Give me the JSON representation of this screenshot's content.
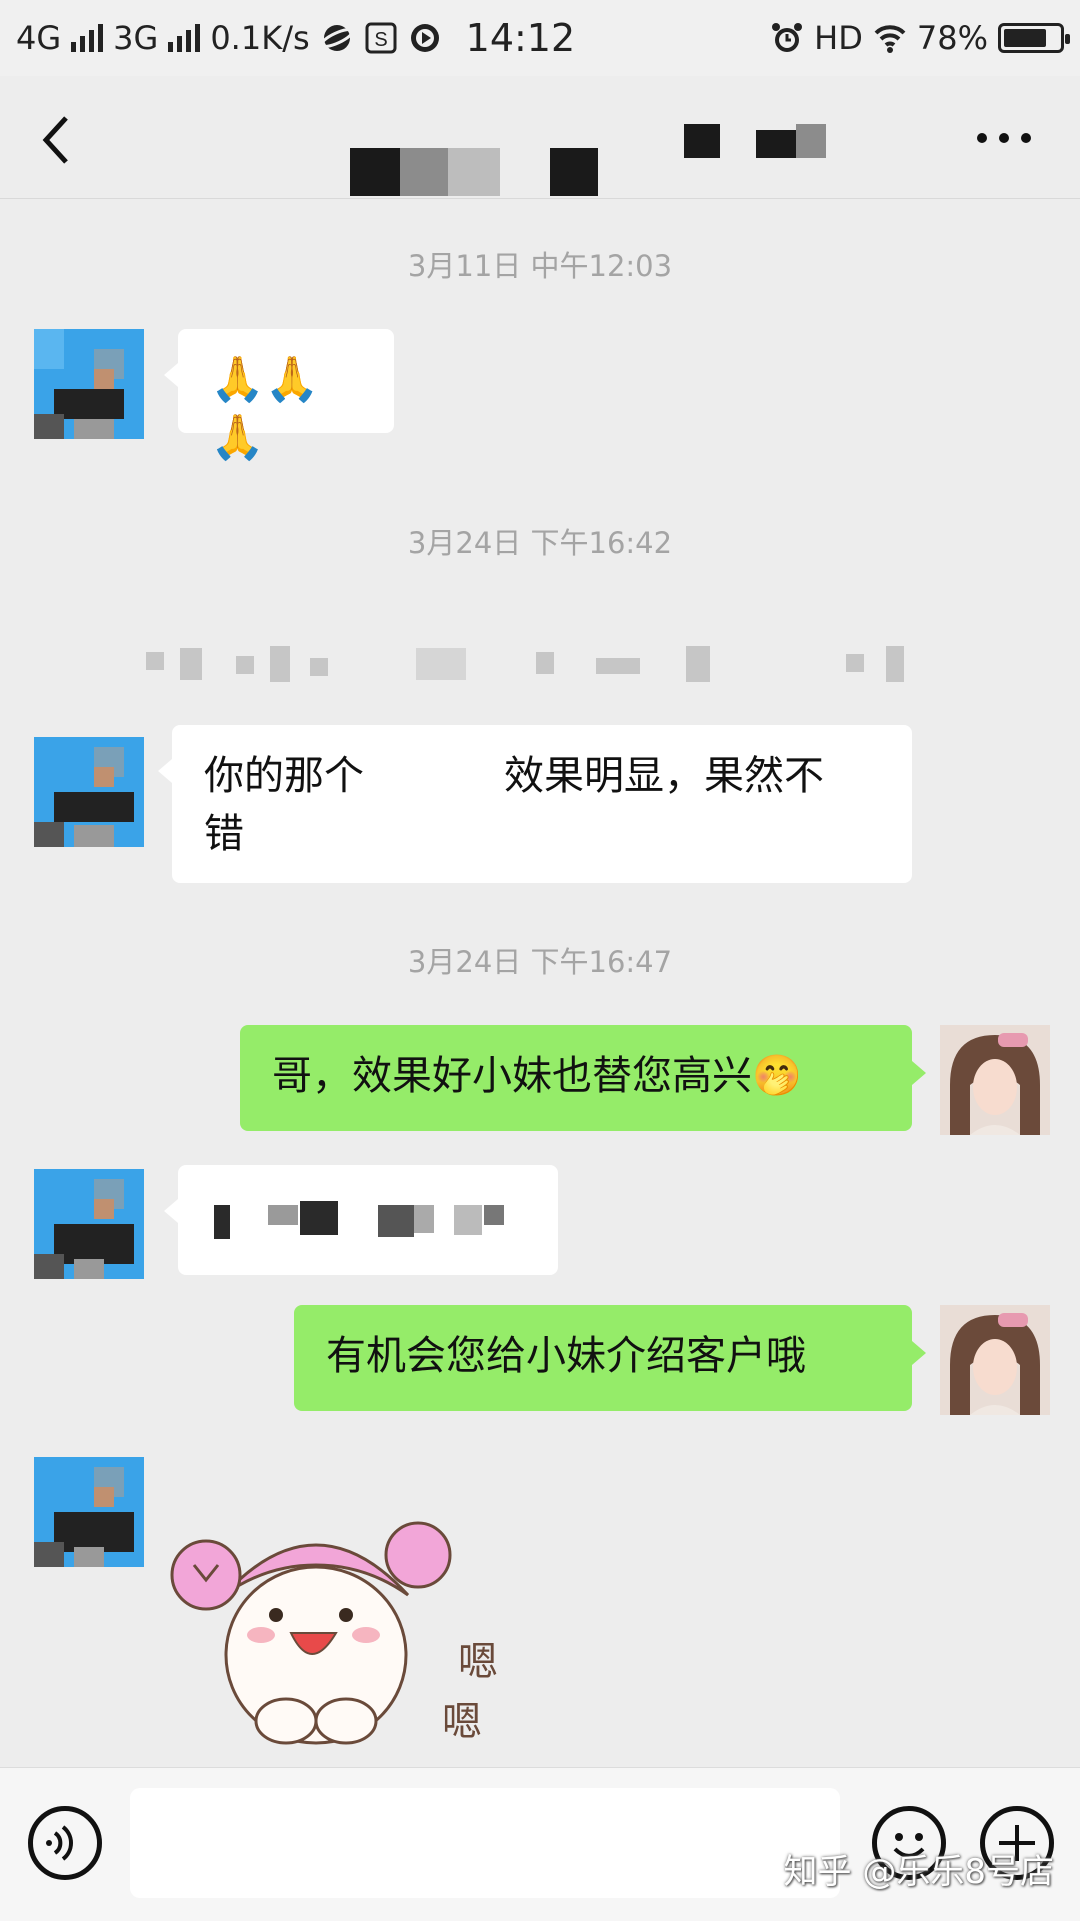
{
  "status_bar": {
    "network_1": "4G",
    "network_2": "3G",
    "speed": "0.1K/s",
    "time": "14:12",
    "hd": "HD",
    "battery_text": "78%",
    "battery_level": 0.78
  },
  "nav": {
    "back_icon": "chevron-left-icon",
    "more_icon": "more-dots-icon"
  },
  "messages": {
    "ts1": "3月11日 中午12:03",
    "ts2": "3月24日 下午16:42",
    "ts3": "3月24日 下午16:47",
    "msg_praying": "🙏🙏🙏",
    "msg_effect_line1": "你的那个",
    "msg_effect_mid": "效果明显，果然不",
    "msg_effect_line2": "错",
    "msg_reply1": "哥，效果好小妹也替您高兴🤭",
    "msg_reply2": "有机会您给小妹介绍客户哦",
    "sticker_text": "嗯\n嗯"
  },
  "colors": {
    "background": "#ededed",
    "bubble_out": "#95ec69",
    "bubble_in": "#ffffff",
    "timestamp": "#a4a4a4"
  },
  "watermark": "知乎 @乐乐8号店"
}
